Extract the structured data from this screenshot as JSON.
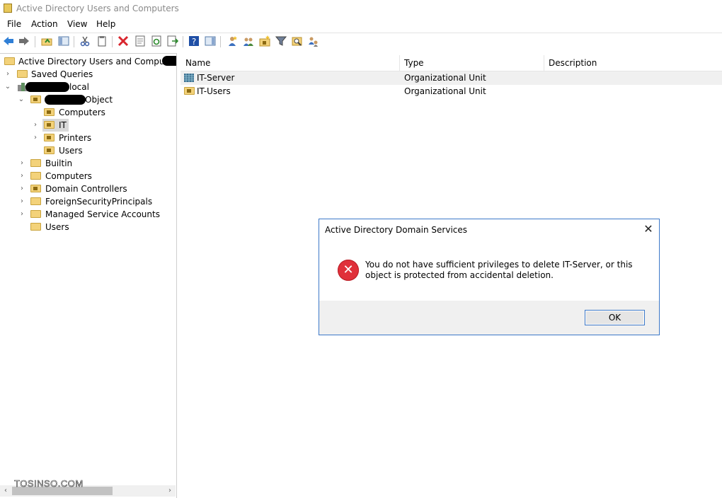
{
  "window": {
    "title": "Active Directory Users and Computers"
  },
  "menu": [
    "File",
    "Action",
    "View",
    "Help"
  ],
  "toolbar_icons": [
    "back-arrow-icon",
    "forward-arrow-icon",
    "up-folder-icon",
    "show-console-tree-icon",
    "cut-icon",
    "copy-icon",
    "delete-icon",
    "properties-icon",
    "refresh-icon",
    "export-list-icon",
    "help-icon",
    "show-action-pane-icon",
    "new-user-icon",
    "new-group-icon",
    "new-ou-icon",
    "filter-icon",
    "find-icon",
    "add-to-group-icon"
  ],
  "tree": {
    "root": "Active Directory Users and Computers [",
    "saved_queries": "Saved Queries",
    "domain_suffix": "local",
    "object_suffix": "Object",
    "ou_children": [
      "Computers",
      "IT",
      "Printers",
      "Users"
    ],
    "containers": [
      "Builtin",
      "Computers",
      "Domain Controllers",
      "ForeignSecurityPrincipals",
      "Managed Service Accounts",
      "Users"
    ]
  },
  "list": {
    "columns": [
      "Name",
      "Type",
      "Description"
    ],
    "rows": [
      {
        "name": "IT-Server",
        "type": "Organizational Unit"
      },
      {
        "name": "IT-Users",
        "type": "Organizational Unit"
      }
    ]
  },
  "dialog": {
    "title": "Active Directory Domain Services",
    "message": "You do not have sufficient privileges to delete IT-Server, or this object is protected from accidental deletion.",
    "ok": "OK",
    "icon": "error-icon",
    "close_glyph": "✕",
    "error_glyph": "✕"
  },
  "watermark": "TOSINSO.COM",
  "colors": {
    "accent": "#3c78c8",
    "error": "#e0303a",
    "folder": "#f3d27a"
  }
}
